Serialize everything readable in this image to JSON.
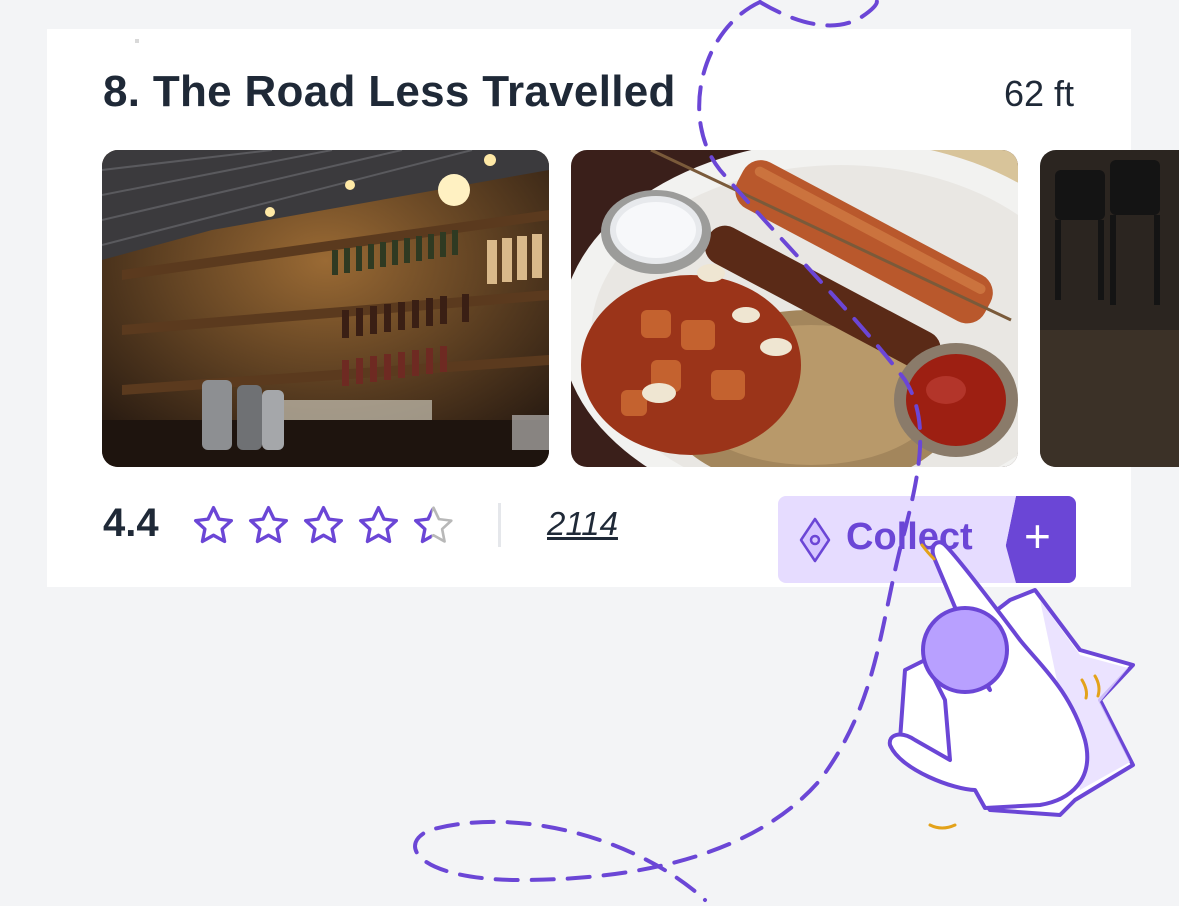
{
  "place": {
    "title": "8. The Road Less Travelled",
    "distance": "62 ft"
  },
  "rating": {
    "value": "4.4",
    "stars_filled": 4.4,
    "stars_max": 5,
    "review_count": "2114"
  },
  "actions": {
    "collect_label": "Collect",
    "add_symbol": "+"
  },
  "photos": [
    {
      "subject": "bar-interior"
    },
    {
      "subject": "kebab-plate"
    },
    {
      "subject": "dining-chairs"
    }
  ],
  "colors": {
    "accent": "#6b46d6",
    "accent_light": "#e6dcff",
    "text": "#1f2937",
    "background": "#f3f4f6"
  }
}
